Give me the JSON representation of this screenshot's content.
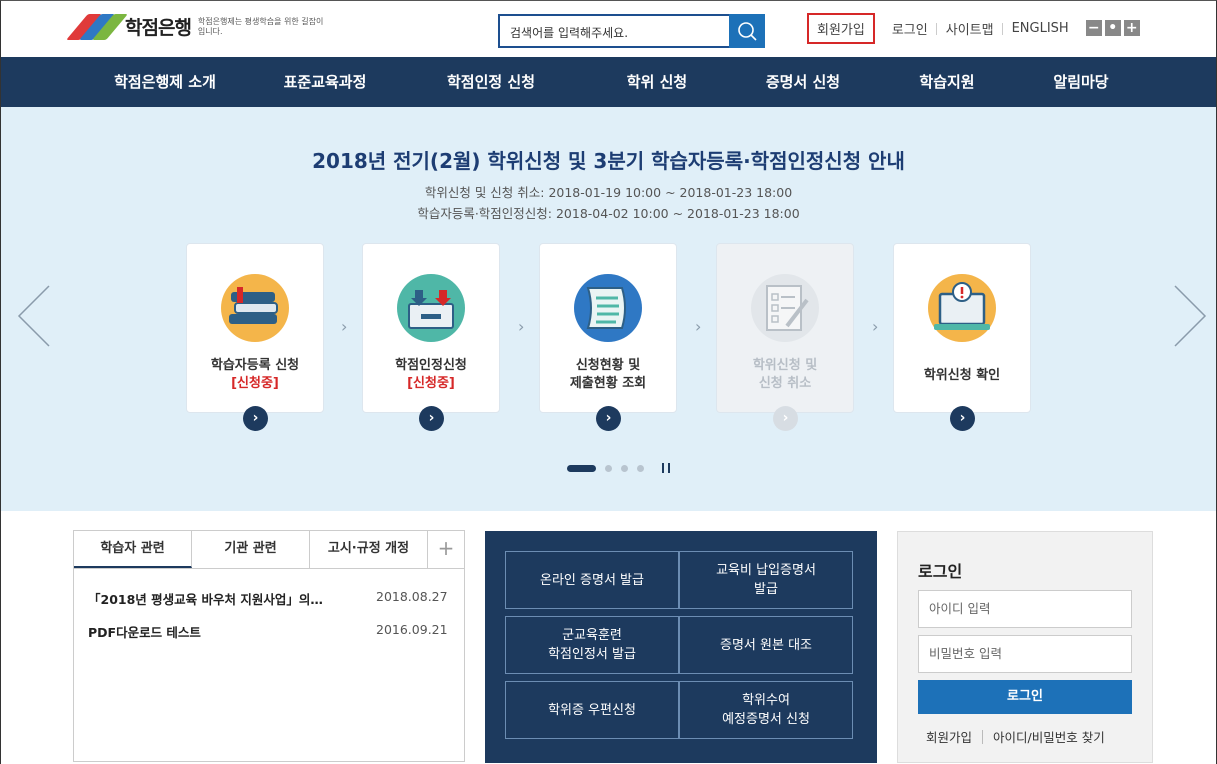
{
  "header": {
    "logo_title": "학점은행",
    "logo_sub": "학점은행제는 평생학습을 위한 길잡이 입니다.",
    "search_placeholder": "검색어를 입력해주세요.",
    "utils": {
      "signup": "회원가입",
      "login": "로그인",
      "sitemap": "사이트맵",
      "english": "ENGLISH"
    },
    "zoom": [
      "−",
      "•",
      "+"
    ]
  },
  "nav": {
    "items": [
      "학점은행제 소개",
      "표준교육과정",
      "학점인정 신청",
      "학위 신청",
      "증명서 신청",
      "학습지원",
      "알림마당"
    ]
  },
  "banner": {
    "title": "2018년 전기(2월) 학위신청 및 3분기 학습자등록·학점인정신청 안내",
    "line1": "학위신청 및 신청 취소: 2018-01-19 10:00 ~ 2018-01-23 18:00",
    "line2": "학습자등록·학점인정신청: 2018-04-02 10:00 ~ 2018-01-23 18:00",
    "cards": [
      {
        "line1": "학습자등록 신청",
        "line2": "[신청중]",
        "icon": "books-icon"
      },
      {
        "line1": "학점인정신청",
        "line2": "[신청중]",
        "icon": "inbox-icon"
      },
      {
        "line1": "신청현황 및",
        "line2": "제출현황 조회",
        "icon": "document-icon"
      },
      {
        "line1": "학위신청 및",
        "line2": "신청 취소",
        "icon": "checklist-icon"
      },
      {
        "line1": "학위신청 확인",
        "line2": "",
        "icon": "monitor-alert-icon"
      }
    ],
    "go_glyph": "›"
  },
  "tabs": {
    "items": [
      "학습자 관련",
      "기관 관련",
      "고시·규정 개정"
    ],
    "plus": "+",
    "news": [
      {
        "title": "「2018년 평생교육 바우처 지원사업」의…",
        "date": "2018.08.27"
      },
      {
        "title": "PDF다운로드 테스트",
        "date": "2016.09.21"
      }
    ]
  },
  "certificates": {
    "buttons": [
      {
        "line1": "온라인 증명서 발급",
        "line2": ""
      },
      {
        "line1": "교육비 납입증명서",
        "line2": "발급"
      },
      {
        "line1": "군교육훈련",
        "line2": "학점인정서 발급"
      },
      {
        "line1": "증명서 원본 대조",
        "line2": ""
      },
      {
        "line1": "학위증 우편신청",
        "line2": ""
      },
      {
        "line1": "학위수여",
        "line2": "예정증명서 신청"
      }
    ]
  },
  "login": {
    "title": "로그인",
    "id_placeholder": "아이디 입력",
    "pw_placeholder": "비밀번호 입력",
    "button": "로그인",
    "signup": "회원가입",
    "find": "아이디/비밀번호 찾기"
  },
  "colors": {
    "nav": "#1d3a5e",
    "accent": "#1d71b8",
    "banner_bg": "#e0eff8",
    "highlight": "#d62828"
  }
}
